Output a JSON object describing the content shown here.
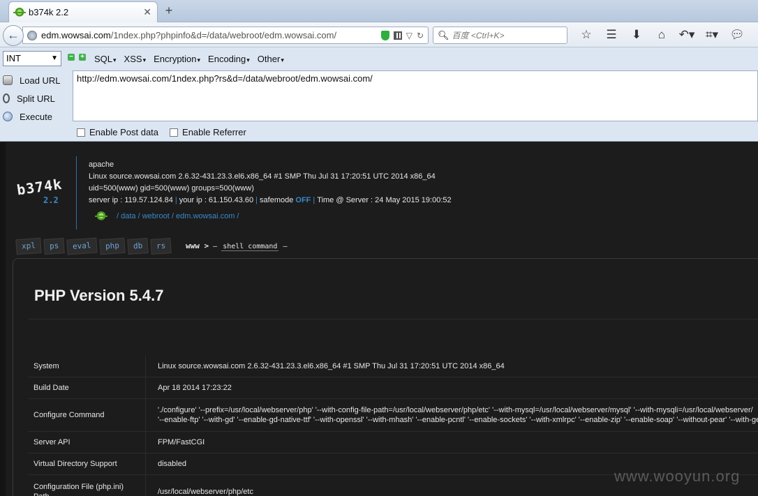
{
  "browser": {
    "tab_title": "b374k 2.2",
    "tab_close": "✕",
    "new_tab": "+",
    "url_domain": "edm.wowsai.com",
    "url_rest": "/1ndex.php?phpinfo&d=/data/webroot/edm.wowsai.com/",
    "search_placeholder": "百度 <Ctrl+K>"
  },
  "hackbar": {
    "select_value": "INT",
    "menus": [
      "SQL",
      "XSS",
      "Encryption",
      "Encoding",
      "Other"
    ],
    "load_url": "Load URL",
    "split_url": "Split URL",
    "execute": "Execute",
    "url_value": "http://edm.wowsai.com/1ndex.php?rs&d=/data/webroot/edm.wowsai.com/",
    "enable_post": "Enable Post data",
    "enable_referrer": "Enable Referrer"
  },
  "shell": {
    "logo": "b374k",
    "version": "2.2",
    "server_software": "apache",
    "uname": "Linux source.wowsai.com 2.6.32-431.23.3.el6.x86_64 #1 SMP Thu Jul 31 17:20:51 UTC 2014 x86_64",
    "ids": "uid=500(www) gid=500(www) groups=500(www)",
    "server_ip_label": "server ip : 119.57.124.84",
    "your_ip_label": "your ip : 61.150.43.60",
    "safemode_label": "safemode",
    "safemode_value": "OFF",
    "time_label": "Time @ Server : 24 May 2015 19:00:52",
    "path": "/ data / webroot / edm.wowsai.com /",
    "tabs": [
      "xpl",
      "ps",
      "eval",
      "php",
      "db",
      "rs"
    ],
    "prompt_user": "www >",
    "prompt_cmd": "shell command"
  },
  "phpinfo": {
    "title": "PHP Version 5.4.7",
    "rows": [
      {
        "key": "System",
        "value": "Linux source.wowsai.com 2.6.32-431.23.3.el6.x86_64 #1 SMP Thu Jul 31 17:20:51 UTC 2014 x86_64",
        "value2": ""
      },
      {
        "key": "Build Date",
        "value": "Apr 18 2014 17:23:22",
        "value2": ""
      },
      {
        "key": "Configure Command",
        "value": "'./configure' '--prefix=/usr/local/webserver/php' '--with-config-file-path=/usr/local/webserver/php/etc' '--with-mysql=/usr/local/webserver/mysql' '--with-mysqli=/usr/local/webserver/",
        "value2": "'--enable-ftp' '--with-gd' '--enable-gd-native-ttf' '--with-openssl' '--with-mhash' '--enable-pcntl' '--enable-sockets' '--with-xmlrpc' '--enable-zip' '--enable-soap' '--without-pear' '--with-get"
      },
      {
        "key": "Server API",
        "value": "FPM/FastCGI",
        "value2": ""
      },
      {
        "key": "Virtual Directory Support",
        "value": "disabled",
        "value2": ""
      },
      {
        "key": "Configuration File (php.ini) Path",
        "value": "/usr/local/webserver/php/etc",
        "value2": ""
      }
    ]
  },
  "watermark": "www.wooyun.org"
}
